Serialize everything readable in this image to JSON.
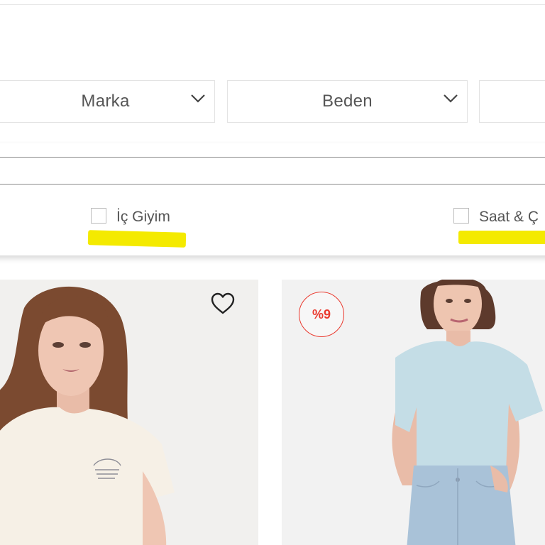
{
  "filters": {
    "brand_label": "Marka",
    "size_label": "Beden"
  },
  "categories": [
    {
      "label": "İç Giyim",
      "checked": false
    },
    {
      "label": "Saat & Ç",
      "checked": false
    }
  ],
  "products": [
    {
      "image": "woman-in-cream-graphic-tshirt",
      "favorite_icon": "heart-icon"
    },
    {
      "image": "woman-in-light-blue-tshirt-and-jeans",
      "discount": "%9"
    }
  ],
  "colors": {
    "highlight": "#f4ea00",
    "discount": "#ea3a2f",
    "text": "#555555"
  }
}
